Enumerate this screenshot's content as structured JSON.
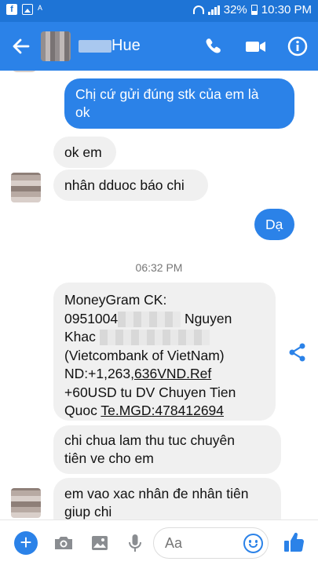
{
  "status_bar": {
    "battery": "32%",
    "time": "10:30 PM"
  },
  "header": {
    "name": "Hue"
  },
  "messages": [
    {
      "dir": "out",
      "lines": [
        "Chị cứ gửi đúng stk của em là",
        "ok"
      ]
    },
    {
      "dir": "in",
      "text": "ok em"
    },
    {
      "dir": "in",
      "text": "nhân dduoc báo chi"
    },
    {
      "dir": "out",
      "text": "Dạ"
    }
  ],
  "timestamp": "06:32 PM",
  "money_message": {
    "line1": "MoneyGram CK:",
    "line2_prefix": "0951004",
    "line2_suffix": "Nguyen",
    "line3": "Khac",
    "line4": "(Vietcombank of VietNam)",
    "line5_a": "ND:+1,263,",
    "line5_b": "636VND.Ref",
    "line6": "+60USD tu DV Chuyen Tien",
    "line7_a": "Quoc ",
    "line7_b": "Te.MGD",
    "line7_c": ":478412694"
  },
  "later_messages": [
    {
      "dir": "in",
      "lines": [
        "chi chua lam thu tuc chuyên",
        "tiên ve cho em"
      ]
    },
    {
      "dir": "in",
      "lines": [
        "em vao xac nhân đe nhân tiên",
        "giup chi"
      ]
    }
  ],
  "composer": {
    "placeholder": "Aa"
  },
  "icons": [
    "back-arrow-icon",
    "phone-icon",
    "video-icon",
    "info-icon",
    "share-icon",
    "plus-icon",
    "camera-icon",
    "image-icon",
    "mic-icon",
    "emoji-icon",
    "thumbs-up-icon"
  ],
  "colors": {
    "accent": "#2b82e8",
    "statusbar": "#1e74d6",
    "bubble_in": "#f0f0f0"
  }
}
